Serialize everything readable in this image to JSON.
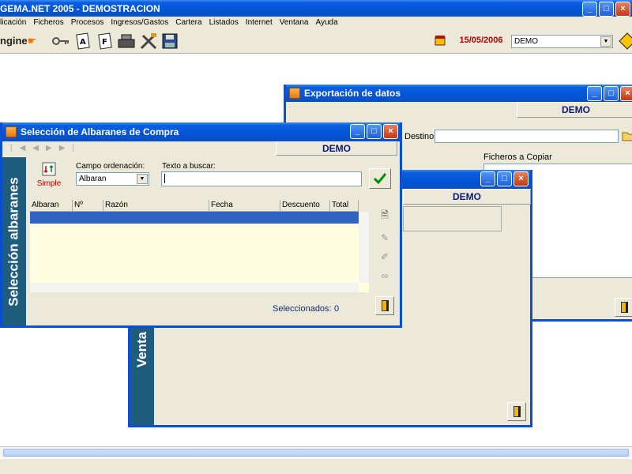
{
  "app": {
    "title": "GEMA.NET 2005 - DEMOSTRACION",
    "menu": [
      "licación",
      "Ficheros",
      "Procesos",
      "Ingresos/Gastos",
      "Cartera",
      "Listados",
      "Internet",
      "Ventana",
      "Ayuda"
    ],
    "logo_text": "ngine",
    "toolbar_icons": [
      "keys-icon",
      "document-a-icon",
      "document-f-icon",
      "cash-register-icon",
      "tools-icon",
      "save-icon"
    ],
    "date": "15/05/2006",
    "company": "DEMO",
    "win_buttons": [
      "_",
      "□",
      "×"
    ]
  },
  "export_window": {
    "title": "Exportación de datos",
    "company": "DEMO",
    "destino_label": "Destino :",
    "ficheros_label": "Ficheros a Copiar"
  },
  "venta_window": {
    "banner": "Venta d",
    "company": "DEMO"
  },
  "seleccion_window": {
    "title": "Selección de Albaranes de Compra",
    "company": "DEMO",
    "banner": "Selección albaranes",
    "simple_label": "Simple",
    "campo_label": "Campo ordenación:",
    "campo_value": "Albaran",
    "texto_label": "Texto a buscar:",
    "texto_value": "",
    "columns": [
      "Albaran",
      "Nº Prov.",
      "Razón",
      "Fecha",
      "Descuento",
      "Total"
    ],
    "seleccionados_label": "Seleccionados:",
    "seleccionados_count": "0"
  }
}
